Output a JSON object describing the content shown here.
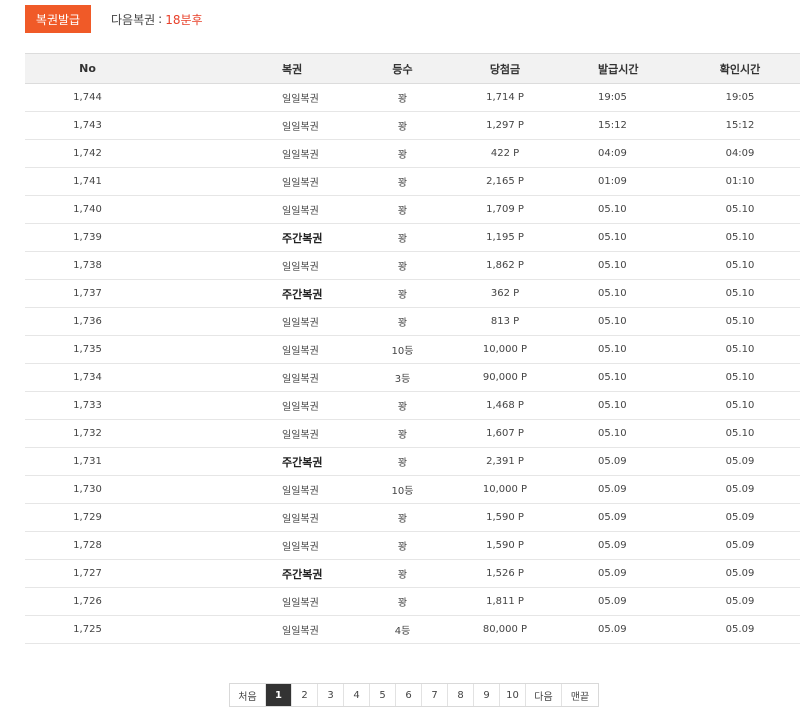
{
  "toolbar": {
    "issue_button": "복권발급",
    "next_label": "다음복권",
    "separator": ":",
    "next_value": "18분후",
    "accent_color": "#f05a28",
    "highlight_color": "#e8402a"
  },
  "table": {
    "headers": [
      "No",
      "복권",
      "등수",
      "당첨금",
      "발급시간",
      "확인시간"
    ],
    "rows": [
      {
        "no": "1,744",
        "type": "일일복권",
        "weekly": false,
        "rank": "꽝",
        "prize": "1,714 P",
        "issued": "19:05",
        "confirmed": "19:05"
      },
      {
        "no": "1,743",
        "type": "일일복권",
        "weekly": false,
        "rank": "꽝",
        "prize": "1,297 P",
        "issued": "15:12",
        "confirmed": "15:12"
      },
      {
        "no": "1,742",
        "type": "일일복권",
        "weekly": false,
        "rank": "꽝",
        "prize": "422 P",
        "issued": "04:09",
        "confirmed": "04:09"
      },
      {
        "no": "1,741",
        "type": "일일복권",
        "weekly": false,
        "rank": "꽝",
        "prize": "2,165 P",
        "issued": "01:09",
        "confirmed": "01:10"
      },
      {
        "no": "1,740",
        "type": "일일복권",
        "weekly": false,
        "rank": "꽝",
        "prize": "1,709 P",
        "issued": "05.10",
        "confirmed": "05.10"
      },
      {
        "no": "1,739",
        "type": "주간복권",
        "weekly": true,
        "rank": "꽝",
        "prize": "1,195 P",
        "issued": "05.10",
        "confirmed": "05.10"
      },
      {
        "no": "1,738",
        "type": "일일복권",
        "weekly": false,
        "rank": "꽝",
        "prize": "1,862 P",
        "issued": "05.10",
        "confirmed": "05.10"
      },
      {
        "no": "1,737",
        "type": "주간복권",
        "weekly": true,
        "rank": "꽝",
        "prize": "362 P",
        "issued": "05.10",
        "confirmed": "05.10"
      },
      {
        "no": "1,736",
        "type": "일일복권",
        "weekly": false,
        "rank": "꽝",
        "prize": "813 P",
        "issued": "05.10",
        "confirmed": "05.10"
      },
      {
        "no": "1,735",
        "type": "일일복권",
        "weekly": false,
        "rank": "10등",
        "prize": "10,000 P",
        "issued": "05.10",
        "confirmed": "05.10"
      },
      {
        "no": "1,734",
        "type": "일일복권",
        "weekly": false,
        "rank": "3등",
        "prize": "90,000 P",
        "issued": "05.10",
        "confirmed": "05.10"
      },
      {
        "no": "1,733",
        "type": "일일복권",
        "weekly": false,
        "rank": "꽝",
        "prize": "1,468 P",
        "issued": "05.10",
        "confirmed": "05.10"
      },
      {
        "no": "1,732",
        "type": "일일복권",
        "weekly": false,
        "rank": "꽝",
        "prize": "1,607 P",
        "issued": "05.10",
        "confirmed": "05.10"
      },
      {
        "no": "1,731",
        "type": "주간복권",
        "weekly": true,
        "rank": "꽝",
        "prize": "2,391 P",
        "issued": "05.09",
        "confirmed": "05.09"
      },
      {
        "no": "1,730",
        "type": "일일복권",
        "weekly": false,
        "rank": "10등",
        "prize": "10,000 P",
        "issued": "05.09",
        "confirmed": "05.09"
      },
      {
        "no": "1,729",
        "type": "일일복권",
        "weekly": false,
        "rank": "꽝",
        "prize": "1,590 P",
        "issued": "05.09",
        "confirmed": "05.09"
      },
      {
        "no": "1,728",
        "type": "일일복권",
        "weekly": false,
        "rank": "꽝",
        "prize": "1,590 P",
        "issued": "05.09",
        "confirmed": "05.09"
      },
      {
        "no": "1,727",
        "type": "주간복권",
        "weekly": true,
        "rank": "꽝",
        "prize": "1,526 P",
        "issued": "05.09",
        "confirmed": "05.09"
      },
      {
        "no": "1,726",
        "type": "일일복권",
        "weekly": false,
        "rank": "꽝",
        "prize": "1,811 P",
        "issued": "05.09",
        "confirmed": "05.09"
      },
      {
        "no": "1,725",
        "type": "일일복권",
        "weekly": false,
        "rank": "4등",
        "prize": "80,000 P",
        "issued": "05.09",
        "confirmed": "05.09"
      }
    ]
  },
  "pagination": {
    "first_label": "처음",
    "pages": [
      "1",
      "2",
      "3",
      "4",
      "5",
      "6",
      "7",
      "8",
      "9",
      "10"
    ],
    "current": "1",
    "next_label": "다음",
    "last_label": "맨끝"
  }
}
